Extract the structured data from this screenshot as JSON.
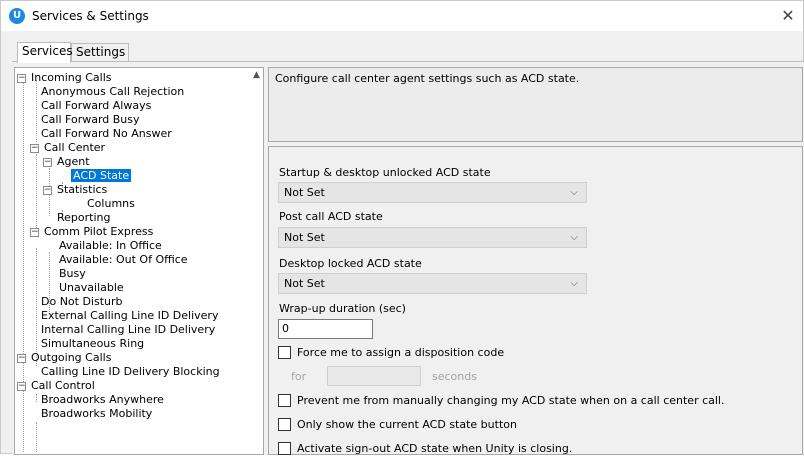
{
  "window": {
    "title": "Services & Settings",
    "app_icon": "unity-logo-icon",
    "app_icon_letter": "U",
    "close_glyph": "✕"
  },
  "tabs": [
    {
      "label": "Services",
      "active": true
    },
    {
      "label": "Settings",
      "active": false
    }
  ],
  "tree": {
    "scroll_glyph": "▲",
    "items": [
      {
        "label": "Incoming Calls",
        "toggle": "−"
      },
      {
        "label": "Anonymous Call Rejection"
      },
      {
        "label": "Call Forward Always"
      },
      {
        "label": "Call Forward Busy"
      },
      {
        "label": "Call Forward No Answer"
      },
      {
        "label": "Call Center",
        "toggle": "−"
      },
      {
        "label": "Agent",
        "toggle": "−"
      },
      {
        "label": "ACD State",
        "selected": true
      },
      {
        "label": "Statistics",
        "toggle": "−"
      },
      {
        "label": "Columns"
      },
      {
        "label": "Reporting"
      },
      {
        "label": "Comm Pilot Express",
        "toggle": "−"
      },
      {
        "label": "Available: In Office"
      },
      {
        "label": "Available: Out Of Office"
      },
      {
        "label": "Busy"
      },
      {
        "label": "Unavailable"
      },
      {
        "label": "Do Not Disturb"
      },
      {
        "label": "External Calling Line ID Delivery"
      },
      {
        "label": "Internal Calling Line ID Delivery"
      },
      {
        "label": "Simultaneous Ring"
      },
      {
        "label": "Outgoing Calls",
        "toggle": "−"
      },
      {
        "label": "Calling Line ID Delivery Blocking"
      },
      {
        "label": "Call Control",
        "toggle": "−"
      },
      {
        "label": "Broadworks Anywhere"
      },
      {
        "label": "Broadworks Mobility"
      }
    ]
  },
  "description": "Configure call center agent settings such as ACD state.",
  "settings": {
    "startup_label": "Startup & desktop unlocked ACD state",
    "startup_value": "Not Set",
    "post_call_label": "Post call ACD state",
    "post_call_value": "Not Set",
    "locked_label": "Desktop locked ACD state",
    "locked_value": "Not Set",
    "wrapup_label": "Wrap-up duration (sec)",
    "wrapup_value": "0",
    "force_disposition_label": "Force me to assign a disposition code",
    "for_label": "for",
    "seconds_label": "seconds",
    "prevent_change_label": "Prevent me from manually changing my ACD state when on a call center call.",
    "only_current_label": "Only show the current ACD state button",
    "signout_label": "Activate sign-out ACD state when Unity is closing.",
    "chevron_glyph": "⌵"
  }
}
